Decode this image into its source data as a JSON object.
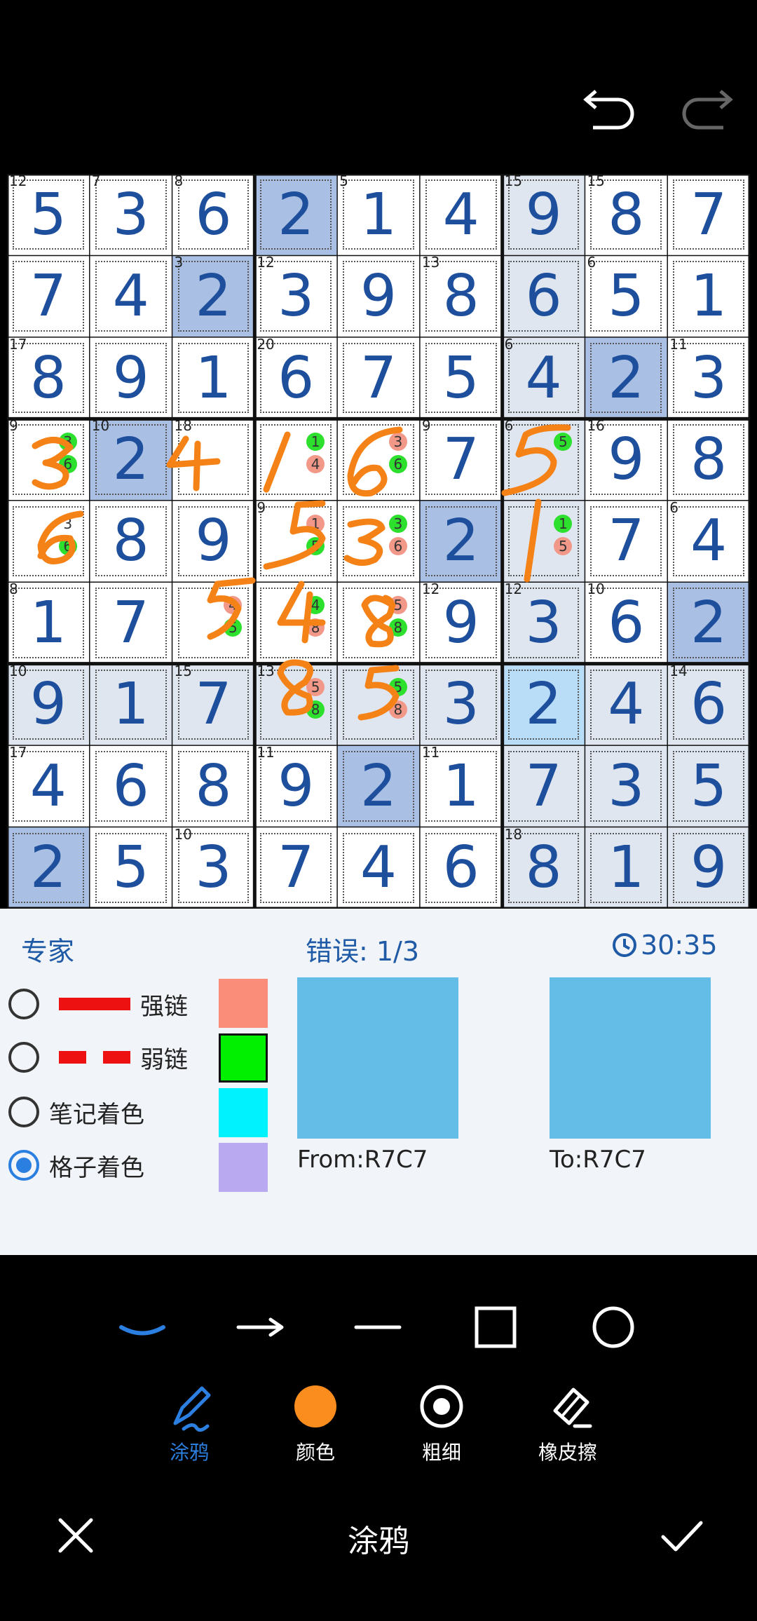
{
  "toolbar": {
    "undo_icon": "undo-icon",
    "redo_icon": "redo-icon"
  },
  "board": {
    "rows": [
      [
        5,
        3,
        6,
        2,
        1,
        4,
        9,
        8,
        7
      ],
      [
        7,
        4,
        2,
        3,
        9,
        8,
        6,
        5,
        1
      ],
      [
        8,
        9,
        1,
        6,
        7,
        5,
        4,
        2,
        3
      ],
      [
        null,
        2,
        null,
        null,
        null,
        7,
        null,
        9,
        8
      ],
      [
        null,
        8,
        9,
        null,
        null,
        2,
        null,
        7,
        4
      ],
      [
        1,
        7,
        null,
        null,
        null,
        9,
        3,
        6,
        2
      ],
      [
        9,
        1,
        7,
        null,
        null,
        3,
        2,
        4,
        6
      ],
      [
        4,
        6,
        8,
        9,
        2,
        1,
        7,
        3,
        5
      ],
      [
        2,
        5,
        3,
        7,
        4,
        6,
        8,
        1,
        9
      ]
    ],
    "cage_sums": [
      {
        "r": 0,
        "c": 0,
        "v": "12"
      },
      {
        "r": 0,
        "c": 1,
        "v": "7"
      },
      {
        "r": 0,
        "c": 2,
        "v": "8"
      },
      {
        "r": 0,
        "c": 4,
        "v": "5"
      },
      {
        "r": 0,
        "c": 6,
        "v": "15"
      },
      {
        "r": 0,
        "c": 7,
        "v": "15"
      },
      {
        "r": 1,
        "c": 2,
        "v": "3"
      },
      {
        "r": 1,
        "c": 3,
        "v": "12"
      },
      {
        "r": 1,
        "c": 5,
        "v": "13"
      },
      {
        "r": 1,
        "c": 7,
        "v": "6"
      },
      {
        "r": 2,
        "c": 0,
        "v": "17"
      },
      {
        "r": 2,
        "c": 3,
        "v": "20"
      },
      {
        "r": 2,
        "c": 6,
        "v": "6"
      },
      {
        "r": 2,
        "c": 8,
        "v": "11"
      },
      {
        "r": 3,
        "c": 0,
        "v": "9"
      },
      {
        "r": 3,
        "c": 1,
        "v": "10"
      },
      {
        "r": 3,
        "c": 2,
        "v": "18"
      },
      {
        "r": 3,
        "c": 5,
        "v": "9"
      },
      {
        "r": 3,
        "c": 6,
        "v": "6"
      },
      {
        "r": 3,
        "c": 7,
        "v": "16"
      },
      {
        "r": 4,
        "c": 3,
        "v": "9"
      },
      {
        "r": 4,
        "c": 8,
        "v": "6"
      },
      {
        "r": 5,
        "c": 0,
        "v": "8"
      },
      {
        "r": 5,
        "c": 5,
        "v": "12"
      },
      {
        "r": 5,
        "c": 6,
        "v": "12"
      },
      {
        "r": 5,
        "c": 7,
        "v": "10"
      },
      {
        "r": 6,
        "c": 0,
        "v": "10"
      },
      {
        "r": 6,
        "c": 2,
        "v": "15"
      },
      {
        "r": 6,
        "c": 3,
        "v": "13"
      },
      {
        "r": 6,
        "c": 8,
        "v": "14"
      },
      {
        "r": 7,
        "c": 0,
        "v": "17"
      },
      {
        "r": 7,
        "c": 3,
        "v": "11"
      },
      {
        "r": 7,
        "c": 5,
        "v": "11"
      },
      {
        "r": 8,
        "c": 2,
        "v": "10"
      },
      {
        "r": 8,
        "c": 6,
        "v": "18"
      }
    ],
    "candidates": [
      {
        "r": 3,
        "c": 0,
        "items": [
          {
            "v": "3",
            "k": "green"
          },
          {
            "v": "6",
            "k": "green"
          }
        ]
      },
      {
        "r": 3,
        "c": 3,
        "items": [
          {
            "v": "1",
            "k": "green"
          },
          {
            "v": "4",
            "k": "red"
          }
        ]
      },
      {
        "r": 3,
        "c": 4,
        "items": [
          {
            "v": "3",
            "k": "red"
          },
          {
            "v": "6",
            "k": "green"
          }
        ]
      },
      {
        "r": 3,
        "c": 6,
        "items": [
          {
            "v": "5",
            "k": "green"
          }
        ]
      },
      {
        "r": 4,
        "c": 0,
        "items": [
          {
            "v": "3",
            "k": "plain"
          },
          {
            "v": "6",
            "k": "green"
          }
        ]
      },
      {
        "r": 4,
        "c": 3,
        "items": [
          {
            "v": "1",
            "k": "red"
          },
          {
            "v": "5",
            "k": "green"
          }
        ]
      },
      {
        "r": 4,
        "c": 4,
        "items": [
          {
            "v": "3",
            "k": "green"
          },
          {
            "v": "6",
            "k": "red"
          }
        ]
      },
      {
        "r": 4,
        "c": 6,
        "items": [
          {
            "v": "1",
            "k": "green"
          },
          {
            "v": "5",
            "k": "red"
          }
        ]
      },
      {
        "r": 5,
        "c": 2,
        "items": [
          {
            "v": "4",
            "k": "red"
          },
          {
            "v": "5",
            "k": "green"
          }
        ]
      },
      {
        "r": 5,
        "c": 3,
        "items": [
          {
            "v": "4",
            "k": "green"
          },
          {
            "v": "8",
            "k": "red"
          }
        ]
      },
      {
        "r": 5,
        "c": 4,
        "items": [
          {
            "v": "5",
            "k": "red"
          },
          {
            "v": "8",
            "k": "green"
          }
        ]
      },
      {
        "r": 6,
        "c": 3,
        "items": [
          {
            "v": "5",
            "k": "red"
          },
          {
            "v": "8",
            "k": "green"
          }
        ]
      },
      {
        "r": 6,
        "c": 4,
        "items": [
          {
            "v": "5",
            "k": "green"
          },
          {
            "v": "8",
            "k": "red"
          }
        ]
      }
    ],
    "highlight_cells": [
      {
        "r": 0,
        "c": 3,
        "k": "mid"
      },
      {
        "r": 1,
        "c": 2,
        "k": "mid"
      },
      {
        "r": 2,
        "c": 7,
        "k": "mid"
      },
      {
        "r": 3,
        "c": 1,
        "k": "mid"
      },
      {
        "r": 4,
        "c": 5,
        "k": "mid"
      },
      {
        "r": 5,
        "c": 8,
        "k": "mid"
      },
      {
        "r": 7,
        "c": 4,
        "k": "mid"
      },
      {
        "r": 8,
        "c": 0,
        "k": "mid"
      },
      {
        "r": 6,
        "c": 6,
        "k": "sel"
      },
      {
        "r": 0,
        "c": 6,
        "k": "light"
      },
      {
        "r": 1,
        "c": 6,
        "k": "light"
      },
      {
        "r": 2,
        "c": 6,
        "k": "light"
      },
      {
        "r": 3,
        "c": 6,
        "k": "light"
      },
      {
        "r": 4,
        "c": 6,
        "k": "light"
      },
      {
        "r": 5,
        "c": 6,
        "k": "light"
      },
      {
        "r": 7,
        "c": 6,
        "k": "light"
      },
      {
        "r": 8,
        "c": 6,
        "k": "light"
      },
      {
        "r": 6,
        "c": 0,
        "k": "light"
      },
      {
        "r": 6,
        "c": 1,
        "k": "light"
      },
      {
        "r": 6,
        "c": 2,
        "k": "light"
      },
      {
        "r": 6,
        "c": 3,
        "k": "light"
      },
      {
        "r": 6,
        "c": 4,
        "k": "light"
      },
      {
        "r": 6,
        "c": 5,
        "k": "light"
      },
      {
        "r": 6,
        "c": 7,
        "k": "light"
      },
      {
        "r": 6,
        "c": 8,
        "k": "light"
      },
      {
        "r": 7,
        "c": 7,
        "k": "light"
      },
      {
        "r": 7,
        "c": 8,
        "k": "light"
      },
      {
        "r": 8,
        "c": 7,
        "k": "light"
      },
      {
        "r": 8,
        "c": 8,
        "k": "light"
      }
    ],
    "colors": {
      "mid": "#a9bfe3",
      "sel": "#b9dcf7",
      "light": "#dfe6f0",
      "digit": "#1e4f9c",
      "ink": "#f58217"
    }
  },
  "status": {
    "difficulty": "专家",
    "errors": "错误: 1/3",
    "timer": "30:35",
    "timer_icon": "clock-icon"
  },
  "options": [
    {
      "label": "强链",
      "selected": false,
      "line": "solid"
    },
    {
      "label": "弱链",
      "selected": false,
      "line": "dashed"
    },
    {
      "label": "笔记着色",
      "selected": false,
      "line": ""
    },
    {
      "label": "格子着色",
      "selected": true,
      "line": ""
    }
  ],
  "swatches": [
    "#fa8c7a",
    "#00f000",
    "#00f2ff",
    "#b8a9f0"
  ],
  "link_from": "From:R7C7",
  "link_to": "To:R7C7",
  "shape_tools": [
    "curve-icon",
    "arrow-icon",
    "line-icon",
    "square-icon",
    "circle-icon"
  ],
  "tools": [
    {
      "label": "涂鸦",
      "icon": "pen-icon",
      "active": true
    },
    {
      "label": "颜色",
      "icon": "color-dot-icon",
      "active": false
    },
    {
      "label": "粗细",
      "icon": "thickness-icon",
      "active": false
    },
    {
      "label": "橡皮擦",
      "icon": "eraser-icon",
      "active": false
    }
  ],
  "footer": {
    "title": "涂鸦",
    "cancel_icon": "close-icon",
    "confirm_icon": "check-icon"
  }
}
